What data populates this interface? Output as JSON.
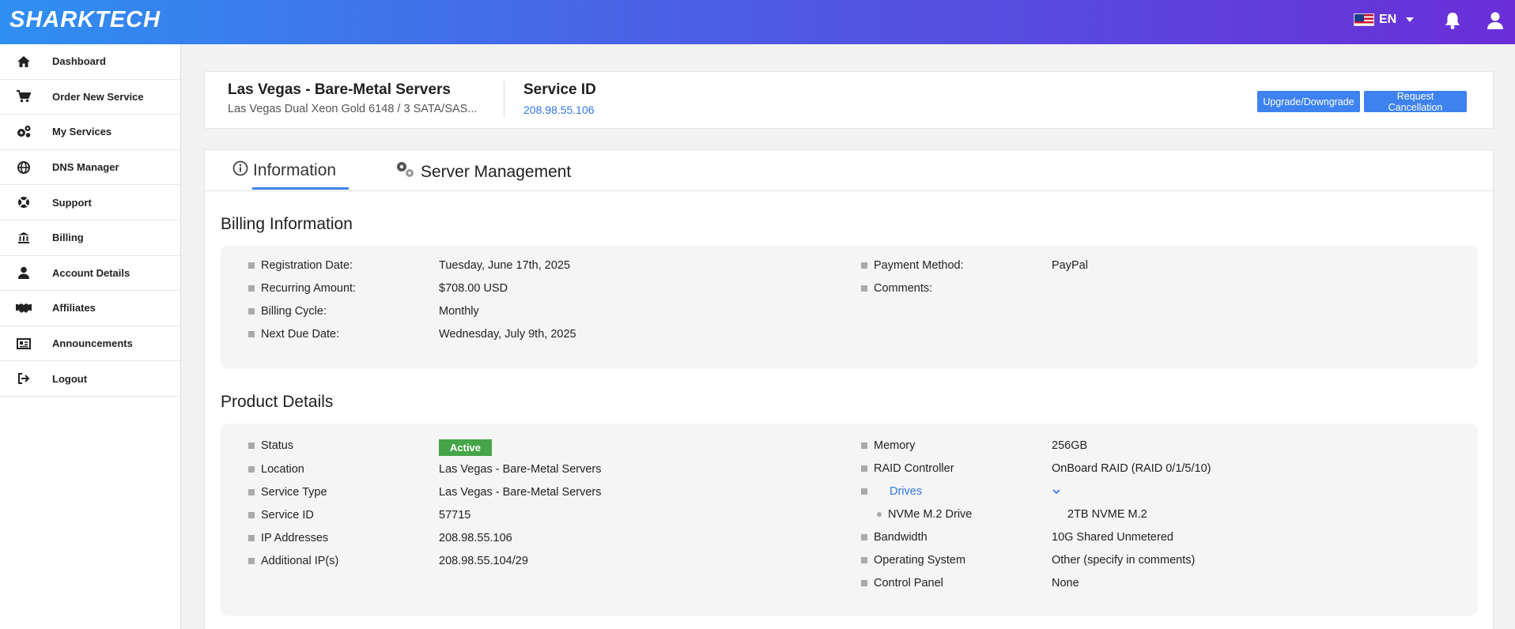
{
  "brand": {
    "logo": "SHARKTECH"
  },
  "header": {
    "language": "EN"
  },
  "sidebar": {
    "items": [
      {
        "label": "Dashboard",
        "icon": "home-icon"
      },
      {
        "label": "Order New Service",
        "icon": "cart-icon"
      },
      {
        "label": "My Services",
        "icon": "cogs-icon"
      },
      {
        "label": "DNS Manager",
        "icon": "globe-icon"
      },
      {
        "label": "Support",
        "icon": "lifebuoy-icon"
      },
      {
        "label": "Billing",
        "icon": "bank-icon"
      },
      {
        "label": "Account Details",
        "icon": "user-icon"
      },
      {
        "label": "Affiliates",
        "icon": "handshake-icon"
      },
      {
        "label": "Announcements",
        "icon": "newspaper-icon"
      },
      {
        "label": "Logout",
        "icon": "logout-icon"
      }
    ]
  },
  "service": {
    "title": "Las Vegas - Bare-Metal Servers",
    "subtitle": "Las Vegas Dual Xeon Gold 6148 / 3 SATA/SAS...",
    "id_label": "Service ID",
    "id_value": "208.98.55.106",
    "upgrade_label": "Upgrade/Downgrade",
    "cancel_label": "Request Cancellation"
  },
  "tabs": {
    "information": "Information",
    "server_management": "Server Management"
  },
  "billing": {
    "title": "Billing Information",
    "left": [
      {
        "label": "Registration Date:",
        "value": "Tuesday, June 17th, 2025"
      },
      {
        "label": "Recurring Amount:",
        "value": "$708.00 USD"
      },
      {
        "label": "Billing Cycle:",
        "value": "Monthly"
      },
      {
        "label": "Next Due Date:",
        "value": "Wednesday, July 9th, 2025"
      }
    ],
    "right": [
      {
        "label": "Payment Method:",
        "value": "PayPal"
      },
      {
        "label": "Comments:",
        "value": ""
      }
    ]
  },
  "product": {
    "title": "Product Details",
    "left": [
      {
        "label": "Status",
        "value": "Active"
      },
      {
        "label": "Location",
        "value": "Las Vegas - Bare-Metal Servers"
      },
      {
        "label": "Service Type",
        "value": "Las Vegas - Bare-Metal Servers"
      },
      {
        "label": "Service ID",
        "value": "57715"
      },
      {
        "label": "IP Addresses",
        "value": "208.98.55.106"
      },
      {
        "label": "Additional IP(s)",
        "value": "208.98.55.104/29"
      }
    ],
    "right": [
      {
        "label": "Memory",
        "value": "256GB"
      },
      {
        "label": "RAID Controller",
        "value": "OnBoard RAID (RAID 0/1/5/10)"
      },
      {
        "label": "Drives",
        "value": ""
      },
      {
        "label": "NVMe M.2 Drive",
        "value": "2TB NVME M.2"
      },
      {
        "label": "Bandwidth",
        "value": "10G Shared Unmetered"
      },
      {
        "label": "Operating System",
        "value": "Other (specify in comments)"
      },
      {
        "label": "Control Panel",
        "value": "None"
      }
    ]
  },
  "colors": {
    "accent": "#3d82ef",
    "active": "#46a548"
  }
}
